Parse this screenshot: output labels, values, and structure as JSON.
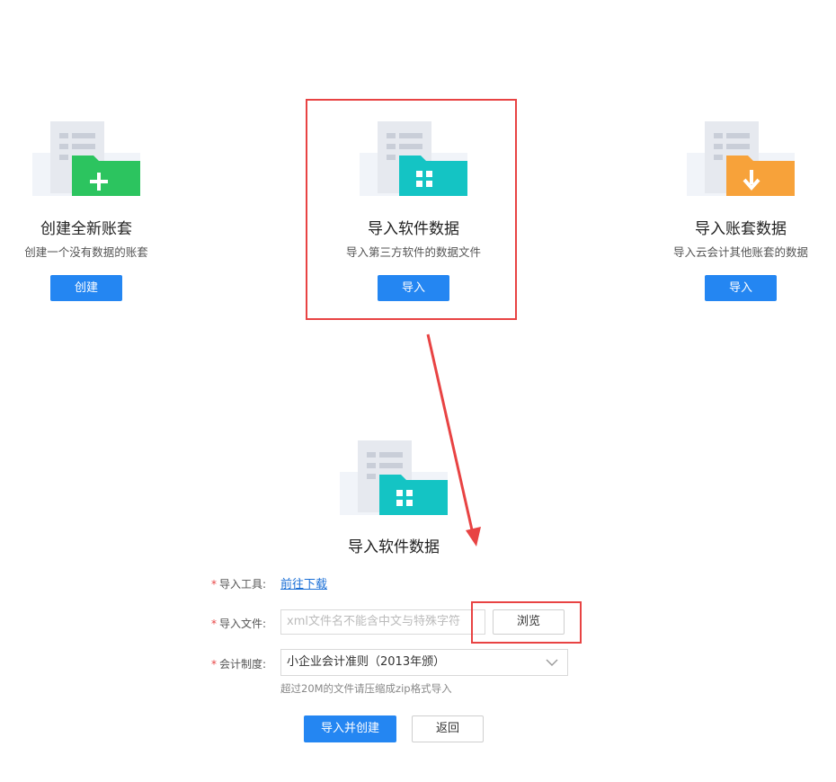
{
  "cards": [
    {
      "title": "创建全新账套",
      "subtitle": "创建一个没有数据的账套",
      "button": "创建",
      "icon": "plus-icon",
      "color": "#2cc45f"
    },
    {
      "title": "导入软件数据",
      "subtitle": "导入第三方软件的数据文件",
      "button": "导入",
      "icon": "grid-icon",
      "color": "#14c4c4"
    },
    {
      "title": "导入账套数据",
      "subtitle": "导入云会计其他账套的数据",
      "button": "导入",
      "icon": "download-arrow-icon",
      "color": "#f7a23a"
    }
  ],
  "form": {
    "title": "导入软件数据",
    "tool_label": "导入工具:",
    "tool_link": "前往下载",
    "file_label": "导入文件:",
    "file_placeholder": "xml文件名不能含中文与特殊字符",
    "browse_button": "浏览",
    "system_label": "会计制度:",
    "system_value": "小企业会计准则（2013年颁）",
    "hint": "超过20M的文件请压缩成zip格式导入",
    "submit_button": "导入并创建",
    "back_button": "返回"
  },
  "colors": {
    "primary": "#2486f2",
    "highlight": "#e84343",
    "folder_teal": "#14c4c4"
  }
}
